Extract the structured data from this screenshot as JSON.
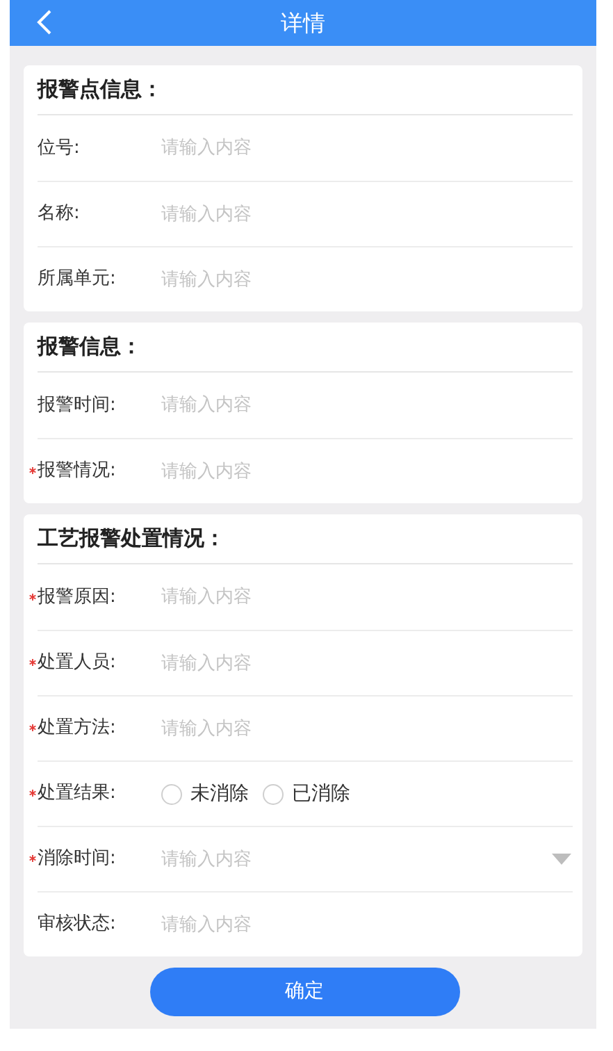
{
  "header": {
    "title": "详情"
  },
  "sections": [
    {
      "title": "报警点信息：",
      "fields": [
        {
          "kind": "input",
          "label": "位号:",
          "required": false,
          "placeholder": "请输入内容"
        },
        {
          "kind": "input",
          "label": "名称:",
          "required": false,
          "placeholder": "请输入内容"
        },
        {
          "kind": "input",
          "label": "所属单元:",
          "required": false,
          "placeholder": "请输入内容"
        }
      ]
    },
    {
      "title": "报警信息：",
      "fields": [
        {
          "kind": "input",
          "label": "报警时间:",
          "required": false,
          "placeholder": "请输入内容"
        },
        {
          "kind": "input",
          "label": "报警情况:",
          "required": true,
          "placeholder": "请输入内容"
        }
      ]
    },
    {
      "title": "工艺报警处置情况：",
      "fields": [
        {
          "kind": "input",
          "label": "报警原因:",
          "required": true,
          "placeholder": "请输入内容"
        },
        {
          "kind": "input",
          "label": "处置人员:",
          "required": true,
          "placeholder": "请输入内容"
        },
        {
          "kind": "input",
          "label": "处置方法:",
          "required": true,
          "placeholder": "请输入内容"
        },
        {
          "kind": "radio",
          "label": "处置结果:",
          "required": true,
          "options": [
            {
              "label": "未消除",
              "selected": false
            },
            {
              "label": "已消除",
              "selected": false
            }
          ]
        },
        {
          "kind": "select",
          "label": "消除时间:",
          "required": true,
          "placeholder": "请输入内容"
        },
        {
          "kind": "input",
          "label": "审核状态:",
          "required": false,
          "placeholder": "请输入内容"
        }
      ]
    }
  ],
  "confirm_button": "确定"
}
